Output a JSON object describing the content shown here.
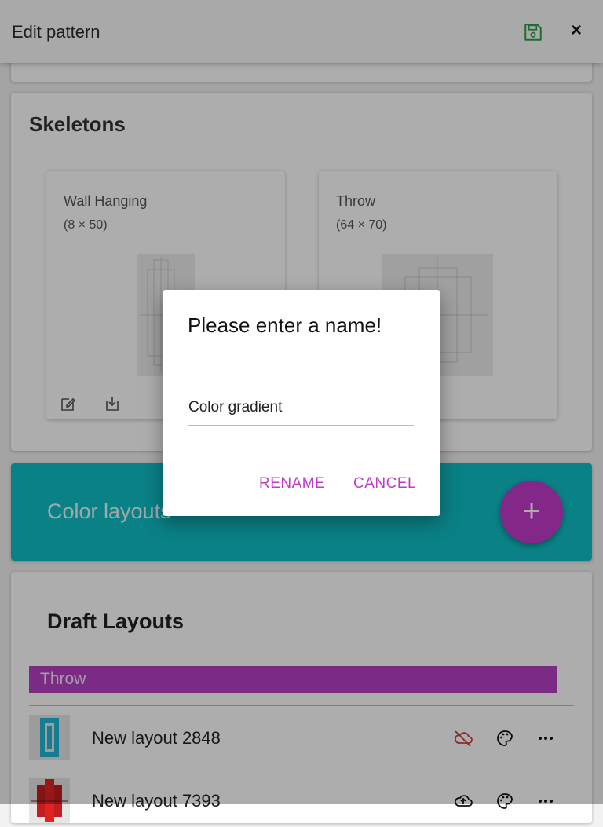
{
  "header": {
    "title": "Edit pattern",
    "save_icon": "save-icon",
    "close_icon": "×"
  },
  "skeletons": {
    "heading": "Skeletons",
    "items": [
      {
        "name": "Wall Hanging",
        "dims": "(8 × 50)"
      },
      {
        "name": "Throw",
        "dims": "(64 × 70)"
      }
    ]
  },
  "color_layouts": {
    "label": "Color layouts",
    "fab": "+"
  },
  "drafts": {
    "heading": "Draft Layouts",
    "group": "Throw",
    "rows": [
      {
        "name": "New layout 2848"
      },
      {
        "name": "New layout 7393"
      }
    ]
  },
  "dialog": {
    "title": "Please enter a name!",
    "field_value": "Color gradient",
    "rename": "RENAME",
    "cancel": "CANCEL"
  },
  "colors": {
    "accent": "#c13ac9",
    "teal": "#0fbfc6",
    "header_save": "#2e9e4f",
    "cloud_off": "#d23b3b"
  }
}
